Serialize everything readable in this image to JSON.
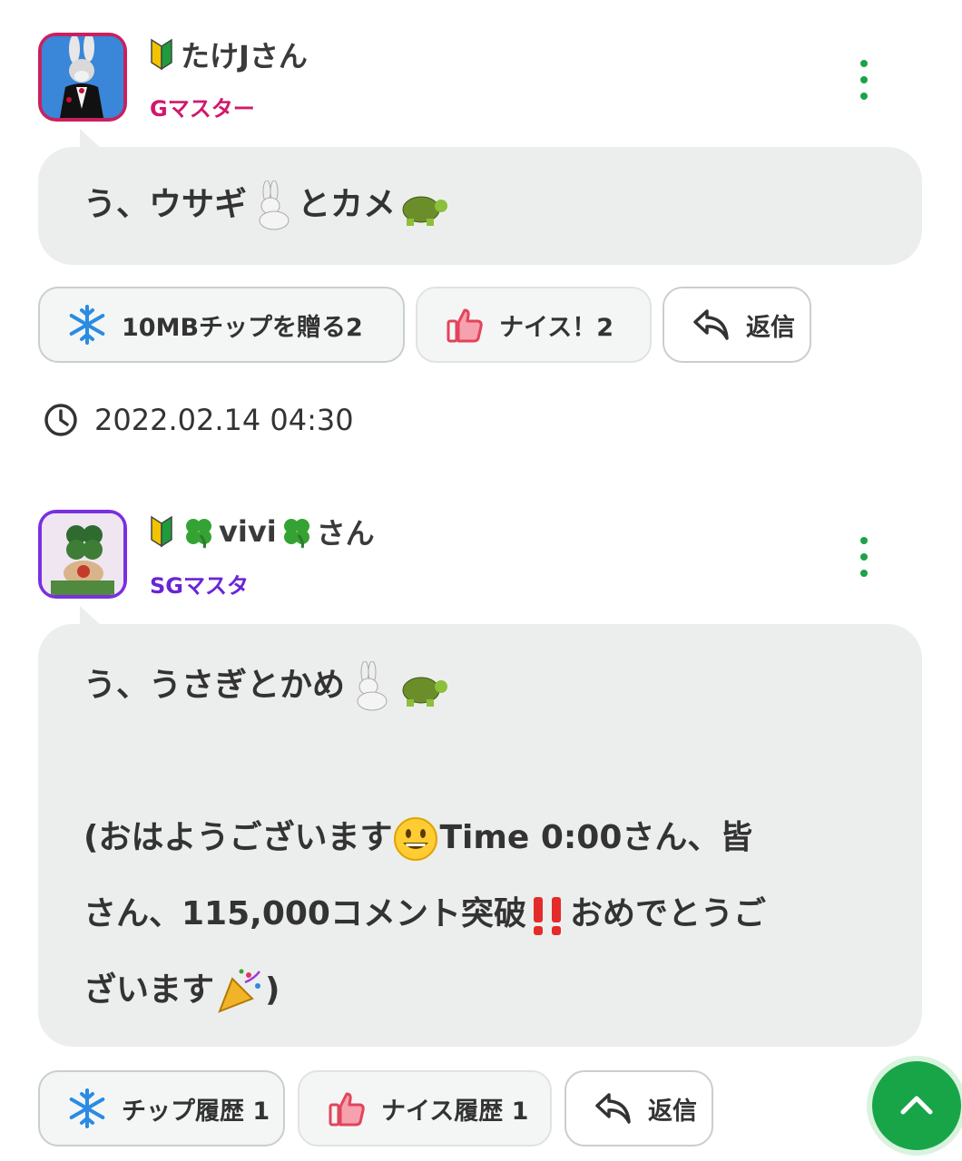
{
  "posts": [
    {
      "user_name": "たけJさん",
      "rank": "Gマスター",
      "rank_color": "#d0196b",
      "avatar_border_color": "#c8215e",
      "message_text_1": "う、ウサギ",
      "message_text_2": "とカメ",
      "buttons": {
        "tip_label": "10MBチップを贈る2",
        "nice_label": "ナイス！2",
        "reply_label": "返信"
      },
      "timestamp": "2022.02.14 04:30"
    },
    {
      "user_name_prefix": "",
      "user_name_core": "vivi",
      "user_name_suffix": "さん",
      "rank": "SGマスタ",
      "rank_color": "#6a24d6",
      "avatar_border_color": "#7a2fe0",
      "line1_text": "う、うさぎとかめ",
      "line2_text_a": "(おはようございます",
      "line2_text_b": "Time 0:00さん、皆",
      "line3_text_a": "さん、115,000コメント突破",
      "line3_text_b": "おめでとうご",
      "line4_text_a": "ざいます",
      "line4_text_b": ")",
      "buttons": {
        "tip_label": "チップ履歴 1",
        "nice_label": "ナイス履歴 1",
        "reply_label": "返信"
      }
    }
  ],
  "icons": {
    "beginner": "beginner-mark-icon",
    "kebab": "more-vertical-icon",
    "snowflake": "snowflake-icon",
    "thumbs_up": "thumbs-up-icon",
    "reply": "reply-arrow-icon",
    "clock": "clock-icon",
    "scroll_top": "chevron-up-icon"
  },
  "colors": {
    "accent_green": "#1aa34a",
    "bubble_bg": "#eceeed"
  }
}
